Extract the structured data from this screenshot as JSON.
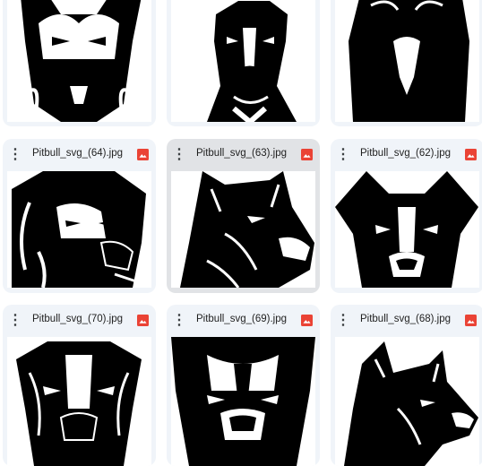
{
  "files": [
    {
      "name": "Pitbull_svg_(64).jpg",
      "type_icon": "image-icon"
    },
    {
      "name": "Pitbull_svg_(63).jpg",
      "type_icon": "image-icon"
    },
    {
      "name": "Pitbull_svg_(62).jpg",
      "type_icon": "image-icon"
    },
    {
      "name": "Pitbull_svg_(70).jpg",
      "type_icon": "image-icon"
    },
    {
      "name": "Pitbull_svg_(69).jpg",
      "type_icon": "image-icon"
    },
    {
      "name": "Pitbull_svg_(68).jpg",
      "type_icon": "image-icon"
    }
  ],
  "menu_glyph": "⋮",
  "colors": {
    "card_bg": "#f0f4f9",
    "card_selected_bg": "#e1e3e6",
    "image_icon": "#ea4335"
  }
}
